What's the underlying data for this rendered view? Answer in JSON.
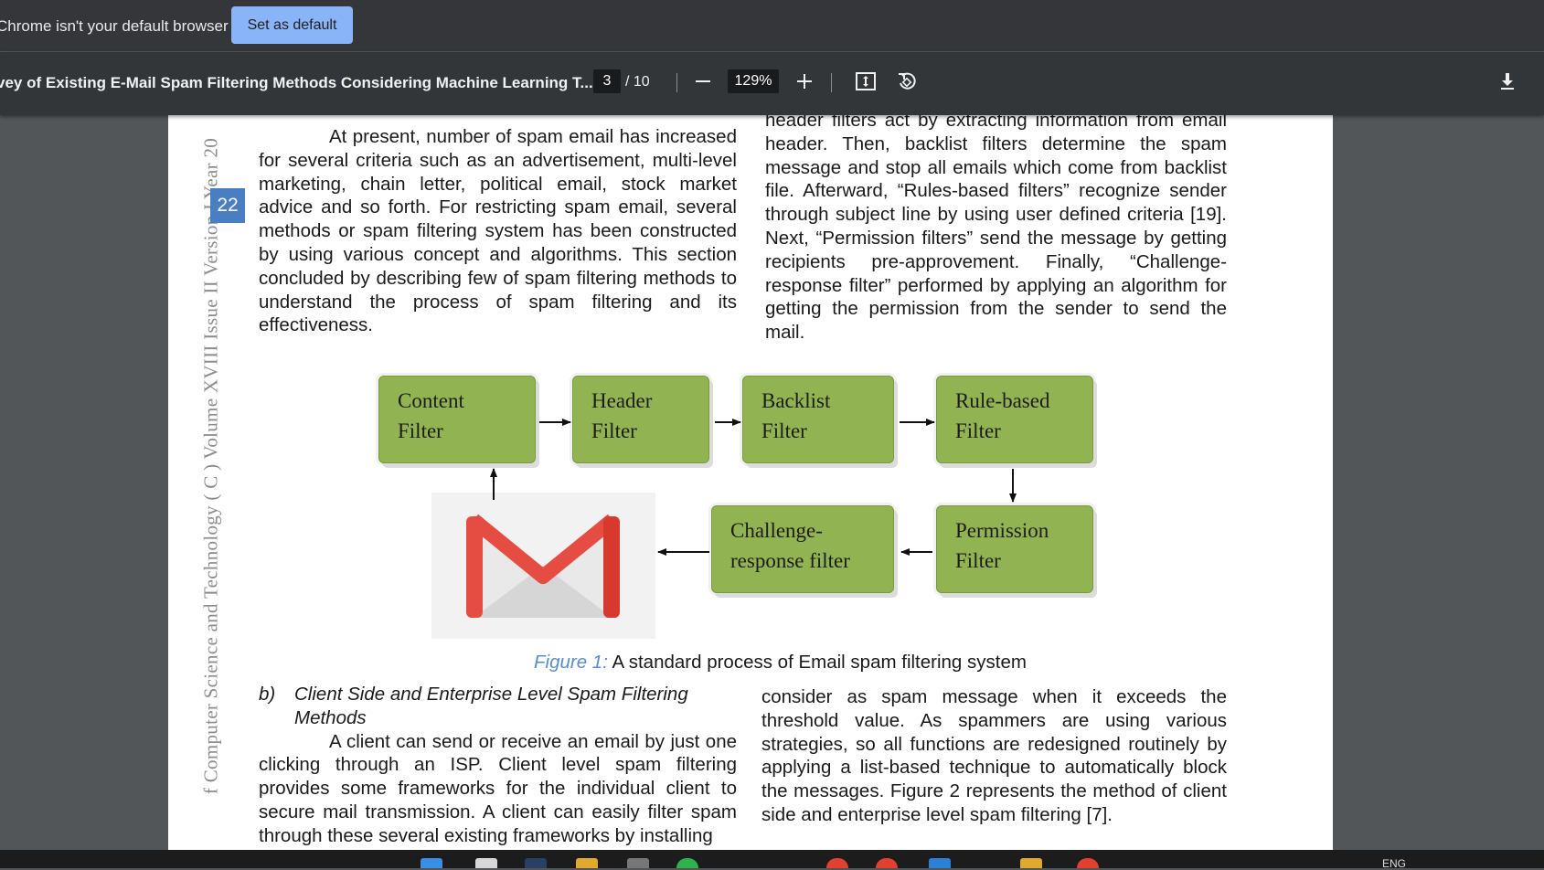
{
  "infobar": {
    "message": "Chrome isn't your default browser",
    "button_label": "Set as default"
  },
  "toolbar": {
    "doc_title": "vey of Existing E-Mail Spam Filtering Methods Considering Machine Learning T...",
    "page_current": "3",
    "page_total": "/ 10",
    "zoom": "129%",
    "icons": [
      "zoom-out-icon",
      "zoom-in-icon",
      "fit-to-page-icon",
      "rotate-icon",
      "download-icon"
    ]
  },
  "page": {
    "running_header": "f Computer Science and Technology ( C ) Volume XVIII Issue II Version I Year 20",
    "page_number": "22",
    "left_col_top": {
      "p1": "At present, number of spam email has increased for several criteria such as an advertisement, multi-level marketing, chain letter, political email, stock market advice and so forth. For restricting spam email, several methods or spam filtering system has been constructed by using various concept and algorithms. This section concluded by describing few of spam filtering methods to understand the process of spam filtering and its effectiveness."
    },
    "right_col_top": {
      "p1": "header filters act by extracting information from email header. Then, backlist filters determine the spam message and stop all emails which come from backlist file. Afterward, “Rules-based filters” recognize sender through subject line by using user defined criteria [19]. Next, “Permission filters” send the message by getting recipients pre-approvement. Finally, “Challenge-response filter” performed by applying an algorithm for getting the permission from the sender to send the mail."
    },
    "diagram": {
      "boxes": {
        "content": [
          "Content",
          "Filter"
        ],
        "header": [
          "Header",
          "Filter"
        ],
        "backlist": [
          "Backlist",
          "Filter"
        ],
        "rule": [
          "Rule-based",
          "Filter"
        ],
        "permission": [
          "Permission",
          "Filter"
        ],
        "challenge": [
          "Challenge-",
          "response filter"
        ]
      }
    },
    "caption": {
      "label": "Figure 1:",
      "text": "A standard process of Email spam filtering system"
    },
    "left_col_bottom": {
      "heading_marker": "b)",
      "heading_line1": "Client Side and Enterprise Level Spam Filtering",
      "heading_line2": "Methods",
      "p1": "A client can send or receive an email by just one clicking through an ISP. Client level spam filtering provides some frameworks for the individual client to secure mail transmission. A client can easily filter spam through these several existing frameworks by installing"
    },
    "right_col_bottom": {
      "p1": "consider as spam message when it exceeds the threshold value. As spammers are using various strategies, so all functions are redesigned routinely by applying a list-based technique to automatically block the messages. Figure 2 represents the method of client side and enterprise level spam filtering [7]."
    }
  },
  "taskbar": {
    "lang": "ENG"
  }
}
